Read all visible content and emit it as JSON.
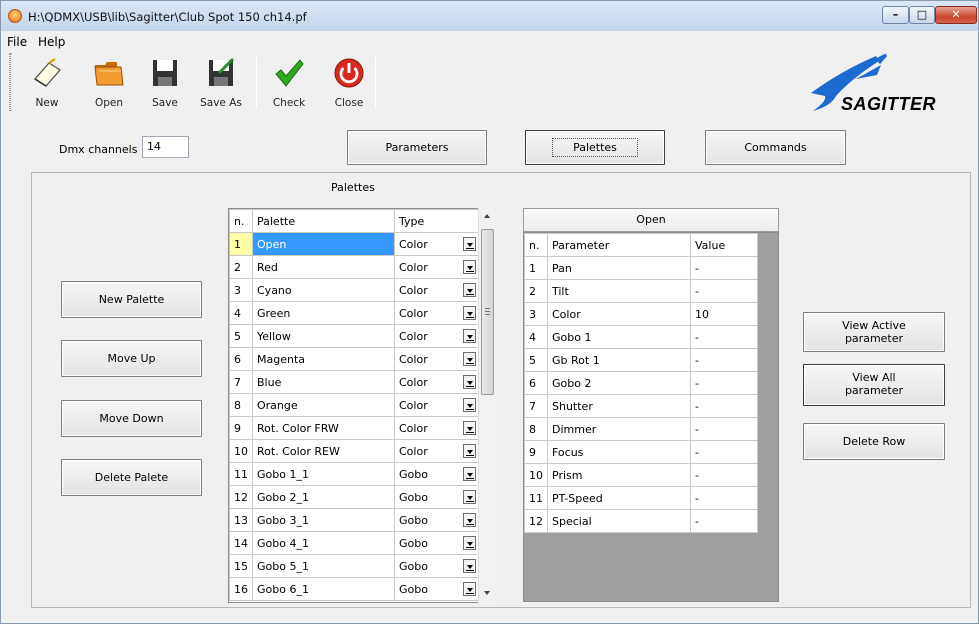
{
  "window": {
    "title": "H:\\QDMX\\USB\\lib\\Sagitter\\Club Spot 150 ch14.pf",
    "min": "–",
    "max": "□",
    "close": "✕"
  },
  "menu": {
    "file": "File",
    "help": "Help"
  },
  "toolbar": {
    "new": "New",
    "open": "Open",
    "save": "Save",
    "save_as": "Save As",
    "check": "Check",
    "close": "Close"
  },
  "logo": {
    "text": "SAGITTER"
  },
  "dmx": {
    "label": "Dmx channels",
    "value": "14"
  },
  "tabs": {
    "parameters": "Parameters",
    "palettes": "Palettes",
    "commands": "Commands"
  },
  "panel": {
    "title": "Palettes"
  },
  "left_buttons": {
    "new_palette": "New Palette",
    "move_up": "Move Up",
    "move_down": "Move Down",
    "delete_palette": "Delete Palete"
  },
  "palettes_table": {
    "headers": {
      "n": "n.",
      "palette": "Palette",
      "type": "Type"
    },
    "rows": [
      {
        "n": "1",
        "name": "Open",
        "type": "Color"
      },
      {
        "n": "2",
        "name": "Red",
        "type": "Color"
      },
      {
        "n": "3",
        "name": "Cyano",
        "type": "Color"
      },
      {
        "n": "4",
        "name": "Green",
        "type": "Color"
      },
      {
        "n": "5",
        "name": "Yellow",
        "type": "Color"
      },
      {
        "n": "6",
        "name": "Magenta",
        "type": "Color"
      },
      {
        "n": "7",
        "name": "Blue",
        "type": "Color"
      },
      {
        "n": "8",
        "name": "Orange",
        "type": "Color"
      },
      {
        "n": "9",
        "name": "Rot. Color FRW",
        "type": "Color"
      },
      {
        "n": "10",
        "name": "Rot. Color REW",
        "type": "Color"
      },
      {
        "n": "11",
        "name": "Gobo 1_1",
        "type": "Gobo"
      },
      {
        "n": "12",
        "name": "Gobo 2_1",
        "type": "Gobo"
      },
      {
        "n": "13",
        "name": "Gobo 3_1",
        "type": "Gobo"
      },
      {
        "n": "14",
        "name": "Gobo 4_1",
        "type": "Gobo"
      },
      {
        "n": "15",
        "name": "Gobo 5_1",
        "type": "Gobo"
      },
      {
        "n": "16",
        "name": "Gobo 6_1",
        "type": "Gobo"
      }
    ]
  },
  "param_table": {
    "title": "Open",
    "headers": {
      "n": "n.",
      "parameter": "Parameter",
      "value": "Value"
    },
    "rows": [
      {
        "n": "1",
        "name": "Pan",
        "value": "-"
      },
      {
        "n": "2",
        "name": "Tilt",
        "value": "-"
      },
      {
        "n": "3",
        "name": "Color",
        "value": "10"
      },
      {
        "n": "4",
        "name": "Gobo 1",
        "value": "-"
      },
      {
        "n": "5",
        "name": "Gb Rot 1",
        "value": "-"
      },
      {
        "n": "6",
        "name": "Gobo 2",
        "value": "-"
      },
      {
        "n": "7",
        "name": "Shutter",
        "value": "-"
      },
      {
        "n": "8",
        "name": "Dimmer",
        "value": "-"
      },
      {
        "n": "9",
        "name": "Focus",
        "value": "-"
      },
      {
        "n": "10",
        "name": "Prism",
        "value": "-"
      },
      {
        "n": "11",
        "name": "PT-Speed",
        "value": "-"
      },
      {
        "n": "12",
        "name": "Special",
        "value": "-"
      }
    ]
  },
  "right_buttons": {
    "view_active_1": "View Active",
    "view_active_2": "parameter",
    "view_all_1": "View All",
    "view_all_2": "parameter",
    "delete_row": "Delete Row"
  },
  "colors": {
    "selection": "#3399ff",
    "current_cell": "#ffffa8",
    "check_green": "#2fa820",
    "close_red": "#d9281e"
  }
}
